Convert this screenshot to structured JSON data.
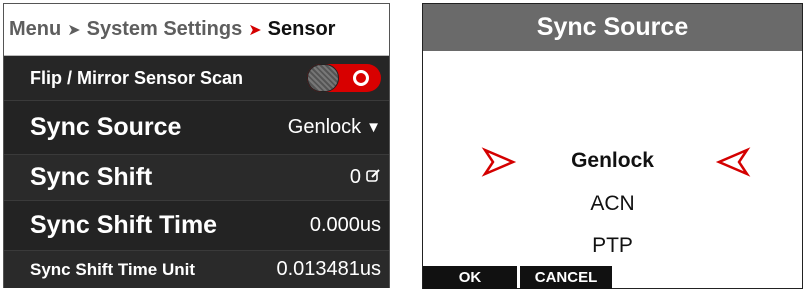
{
  "breadcrumb": {
    "items": [
      "Menu",
      "System Settings"
    ],
    "current": "Sensor",
    "separator": "➤"
  },
  "settings": {
    "flip_mirror": {
      "label": "Flip / Mirror Sensor Scan",
      "state": "on"
    },
    "sync_source": {
      "label": "Sync Source",
      "value": "Genlock"
    },
    "sync_shift": {
      "label": "Sync Shift",
      "value": "0"
    },
    "sync_shift_time": {
      "label": "Sync Shift Time",
      "value": "0.000us"
    },
    "sync_shift_time_unit": {
      "label": "Sync Shift Time Unit",
      "value": "0.013481us"
    }
  },
  "dialog": {
    "title": "Sync Source",
    "options": [
      "Genlock",
      "ACN",
      "PTP"
    ],
    "selected_index": 0,
    "ok_label": "OK",
    "cancel_label": "CANCEL"
  },
  "colors": {
    "accent_red": "#d80000",
    "panel_dark": "#1f1f1f",
    "dialog_title_bg": "#6a6a6a"
  }
}
